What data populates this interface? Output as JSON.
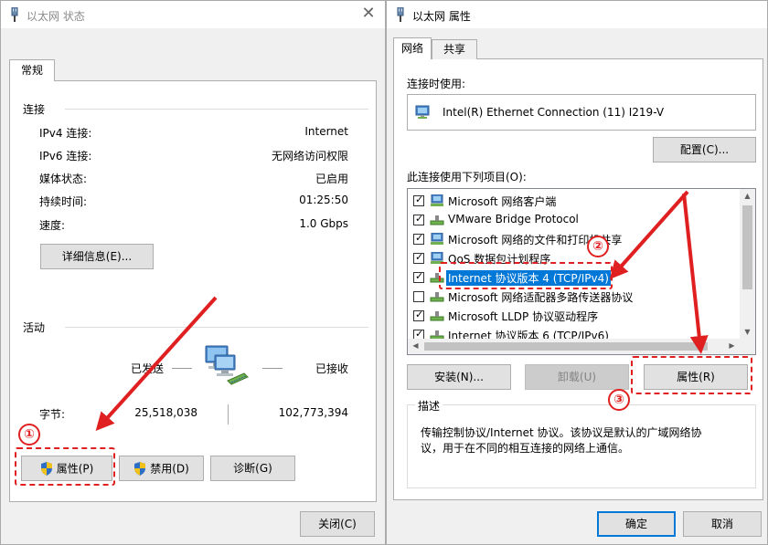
{
  "status_window": {
    "title": "以太网 状态",
    "tab": "常规",
    "connection_section": "连接",
    "rows": [
      {
        "label": "IPv4 连接:",
        "value": "Internet"
      },
      {
        "label": "IPv6 连接:",
        "value": "无网络访问权限"
      },
      {
        "label": "媒体状态:",
        "value": "已启用"
      },
      {
        "label": "持续时间:",
        "value": "01:25:50"
      },
      {
        "label": "速度:",
        "value": "1.0 Gbps"
      }
    ],
    "details_button": "详细信息(E)...",
    "activity_section": "活动",
    "sent_label": "已发送",
    "received_label": "已接收",
    "bytes_label": "字节:",
    "bytes_sent": "25,518,038",
    "bytes_received": "102,773,394",
    "properties_button": "属性(P)",
    "disable_button": "禁用(D)",
    "diagnose_button": "诊断(G)",
    "close_button": "关闭(C)"
  },
  "properties_window": {
    "title": "以太网 属性",
    "tabs": [
      "网络",
      "共享"
    ],
    "connect_using_label": "连接时使用:",
    "adapter_name": "Intel(R) Ethernet Connection (11) I219-V",
    "configure_button": "配置(C)...",
    "items_label": "此连接使用下列项目(O):",
    "items": [
      {
        "label": "Microsoft 网络客户端",
        "checked": true,
        "icon": "network-client-icon"
      },
      {
        "label": "VMware Bridge Protocol",
        "checked": true,
        "icon": "network-protocol-icon"
      },
      {
        "label": "Microsoft 网络的文件和打印机共享",
        "checked": true,
        "icon": "network-service-icon"
      },
      {
        "label": "QoS 数据包计划程序",
        "checked": true,
        "icon": "network-service-icon"
      },
      {
        "label": "Internet 协议版本 4 (TCP/IPv4)",
        "checked": true,
        "selected": true,
        "icon": "network-protocol-icon"
      },
      {
        "label": "Microsoft 网络适配器多路传送器协议",
        "checked": false,
        "icon": "network-protocol-icon"
      },
      {
        "label": "Microsoft LLDP 协议驱动程序",
        "checked": true,
        "icon": "network-protocol-icon"
      },
      {
        "label": "Internet 协议版本 6 (TCP/IPv6)",
        "checked": true,
        "icon": "network-protocol-icon"
      }
    ],
    "install_button": "安装(N)...",
    "uninstall_button": "卸载(U)",
    "properties_button": "属性(R)",
    "description_title": "描述",
    "description_text": "传输控制协议/Internet 协议。该协议是默认的广域网络协议，用于在不同的相互连接的网络上通信。",
    "ok_button": "确定",
    "cancel_button": "取消"
  },
  "annotations": [
    "①",
    "②",
    "③"
  ],
  "colors": {
    "accent": "#0078d7",
    "annotation": "#e02020"
  }
}
